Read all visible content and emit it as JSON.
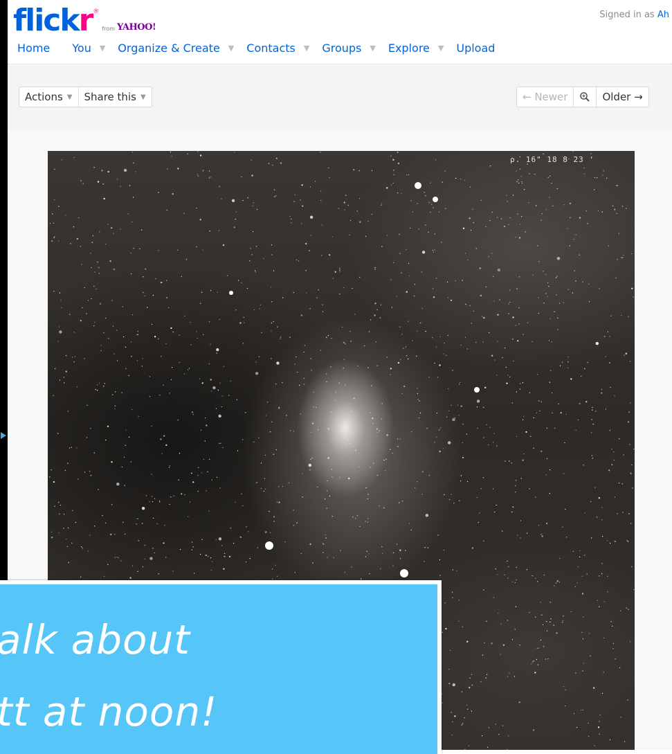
{
  "header": {
    "logo_text_flick": "flick",
    "logo_text_r": "r",
    "logo_from": "from",
    "logo_yahoo": "YAHOO!",
    "signed_in_prefix": "Signed in as",
    "signed_in_user": "Ah"
  },
  "nav": {
    "items": [
      {
        "label": "Home"
      },
      {
        "label": "You"
      },
      {
        "label": "Organize & Create"
      },
      {
        "label": "Contacts"
      },
      {
        "label": "Groups"
      },
      {
        "label": "Explore"
      },
      {
        "label": "Upload"
      }
    ]
  },
  "toolbar": {
    "actions_label": "Actions",
    "share_label": "Share this",
    "newer_label": "← Newer",
    "older_label": "Older →"
  },
  "photo": {
    "plate_label": "ρ. 16\" 18 8 23 '"
  },
  "callout": {
    "line1": "alk about",
    "line2": "tt at noon!"
  },
  "colors": {
    "flickr_blue": "#0063dc",
    "flickr_pink": "#ff0084",
    "yahoo_purple": "#7b0099",
    "callout_bg": "#55c6f7"
  }
}
